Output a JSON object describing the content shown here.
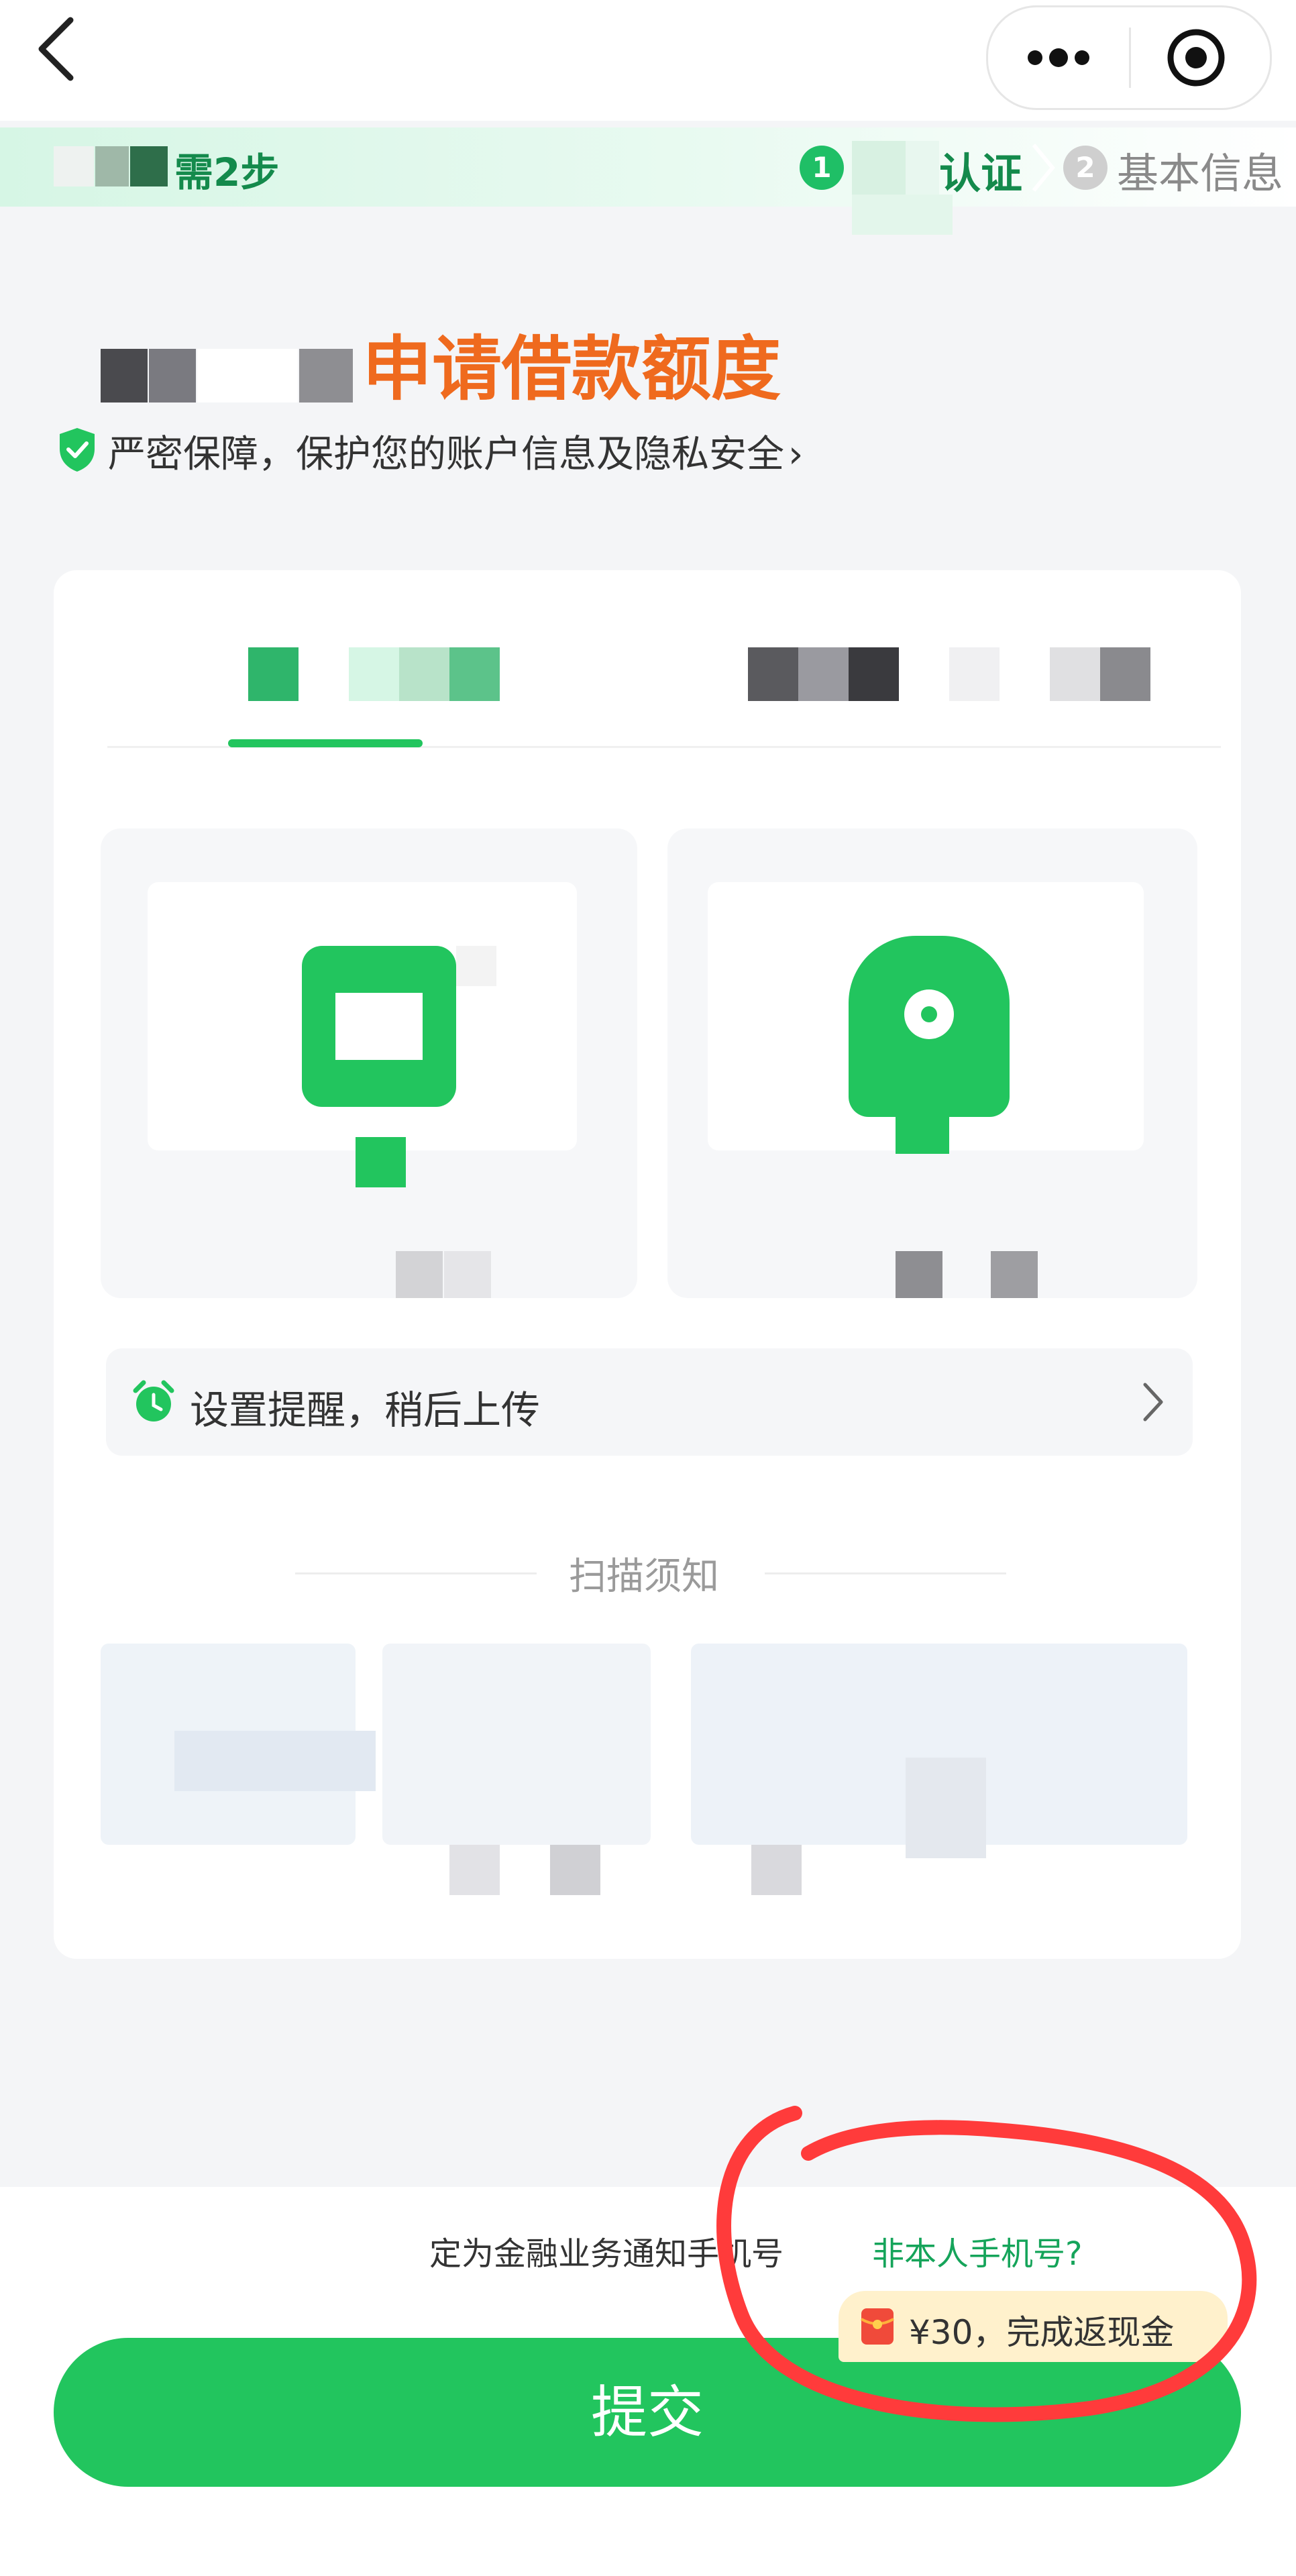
{
  "steps": {
    "remaining_text": "需2步",
    "step1_number": "1",
    "step1_label": "认证",
    "step2_number": "2",
    "step2_label": "基本信息"
  },
  "page": {
    "title": "申请借款额度",
    "secure_note": "严密保障，保护您的账户信息及隐私安全",
    "secure_chevron": "›"
  },
  "reminder": {
    "label": "设置提醒，稍后上传"
  },
  "notice": {
    "title": "扫描须知"
  },
  "bottom": {
    "agree_text": "定为金融业务通知手机号",
    "not_mine_link": "非本人手机号?",
    "cashback_text": "¥30，完成返现金",
    "submit_label": "提交"
  },
  "colors": {
    "accent_green": "#22c55e",
    "title_orange": "#ef6a1e",
    "annotation_red": "#ff3b3b"
  },
  "icons": [
    "back-icon",
    "more-icon",
    "target-icon",
    "shield-icon",
    "alarm-icon",
    "chevron-right-icon",
    "redpacket-icon"
  ]
}
